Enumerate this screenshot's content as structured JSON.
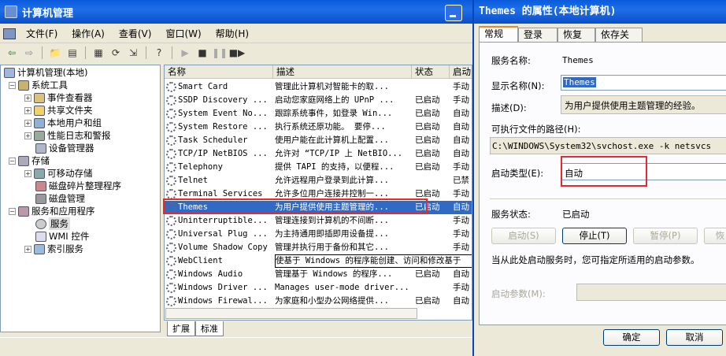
{
  "window": {
    "title": "计算机管理"
  },
  "menu": [
    "文件(F)",
    "操作(A)",
    "查看(V)",
    "窗口(W)",
    "帮助(H)"
  ],
  "tree": {
    "root": "计算机管理(本地)",
    "system_tools": "系统工具",
    "event_viewer": "事件查看器",
    "shared_folders": "共享文件夹",
    "local_users": "本地用户和组",
    "perf_logs": "性能日志和警报",
    "device_manager": "设备管理器",
    "storage": "存储",
    "removable": "可移动存储",
    "defrag": "磁盘碎片整理程序",
    "disk_mgmt": "磁盘管理",
    "services_apps": "服务和应用程序",
    "services": "服务",
    "wmi": "WMI 控件",
    "indexing": "索引服务"
  },
  "list": {
    "headers": [
      "名称",
      "描述",
      "状态",
      "启动"
    ],
    "rows": [
      [
        "Smart Card",
        "管理此计算机对智能卡的取...",
        "",
        "手动"
      ],
      [
        "SSDP Discovery ...",
        "启动您家庭网络上的 UPnP ...",
        "已启动",
        "手动"
      ],
      [
        "System Event No...",
        "跟踪系统事件，如登录 Win...",
        "已启动",
        "自动"
      ],
      [
        "System Restore ...",
        "执行系统还原功能。 要停...",
        "已启动",
        "自动"
      ],
      [
        "Task Scheduler",
        "使用户能在此计算机上配置...",
        "已启动",
        "自动"
      ],
      [
        "TCP/IP NetBIOS ...",
        "允许对 “TCP/IP 上 NetBIO...",
        "已启动",
        "自动"
      ],
      [
        "Telephony",
        "提供 TAPI 的支持，以便程...",
        "已启动",
        "手动"
      ],
      [
        "Telnet",
        "允许远程用户登录到此计算...",
        "",
        "已禁"
      ],
      [
        "Terminal Services",
        "允许多位用户连接并控制一...",
        "已启动",
        "手动"
      ],
      [
        "Themes",
        "为用户提供使用主题管理的...",
        "已启动",
        "自动"
      ],
      [
        "Uninterruptible...",
        "管理连接到计算机的不间断...",
        "",
        "手动"
      ],
      [
        "Universal Plug ...",
        "为主持通用即插即用设备提...",
        "",
        "手动"
      ],
      [
        "Volume Shadow Copy",
        "管理并执行用于备份和其它...",
        "",
        "手动"
      ],
      [
        "WebClient",
        "使基于 Windows 的程序能创建、访问和修改基于",
        "",
        ""
      ],
      [
        "Windows Audio",
        "管理基于 Windows 的程序...",
        "已启动",
        "自动"
      ],
      [
        "Windows Driver ...",
        "Manages user-mode driver...",
        "",
        "手动"
      ],
      [
        "Windows Firewal...",
        "为家庭和小型办公网络提供...",
        "已启动",
        "自动"
      ]
    ]
  },
  "bottom_tabs": [
    "扩展",
    "标准"
  ],
  "dialog": {
    "title": "Themes 的属性(本地计算机)",
    "tabs": [
      "常规",
      "登录",
      "恢复",
      "依存关系"
    ],
    "service_name_label": "服务名称:",
    "service_name": "Themes",
    "display_name_label": "显示名称(N):",
    "display_name": "Themes",
    "description_label": "描述(D):",
    "description": "为用户提供使用主题管理的经验。",
    "path_label": "可执行文件的路径(H):",
    "path": "C:\\WINDOWS\\System32\\svchost.exe -k netsvcs",
    "startup_type_label": "启动类型(E):",
    "startup_type": "自动",
    "status_label": "服务状态:",
    "status": "已启动",
    "btn_start": "启动(S)",
    "btn_stop": "停止(T)",
    "btn_pause": "暂停(P)",
    "btn_resume": "恢",
    "hint": "当从此处启动服务时，您可指定所适用的启动参数。",
    "params_label": "启动参数(M):",
    "ok": "确定",
    "cancel": "取消"
  }
}
